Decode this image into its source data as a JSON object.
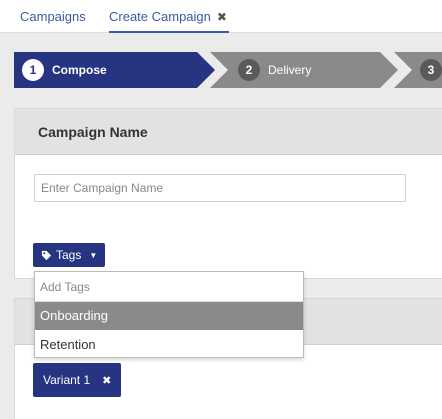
{
  "tabs": {
    "campaigns_label": "Campaigns",
    "create_label": "Create Campaign",
    "close_glyph": "✖"
  },
  "steps": [
    {
      "number": "1",
      "label": "Compose",
      "state": "active"
    },
    {
      "number": "2",
      "label": "Delivery",
      "state": "idle"
    },
    {
      "number": "3",
      "label": "",
      "state": "idle"
    }
  ],
  "colors": {
    "accent": "#263482",
    "step_idle": "#8a8a8a",
    "link": "#3d5aa8"
  },
  "campaign_panel": {
    "title": "Campaign Name",
    "name_placeholder": "Enter Campaign Name",
    "name_value": ""
  },
  "tags": {
    "button_label": "Tags",
    "icon": "tag-icon",
    "search_placeholder": "Add Tags",
    "options": [
      "Onboarding",
      "Retention"
    ],
    "highlighted_option": "Onboarding"
  },
  "variants": {
    "chip_label": "Variant 1",
    "remove_glyph": "✖"
  }
}
